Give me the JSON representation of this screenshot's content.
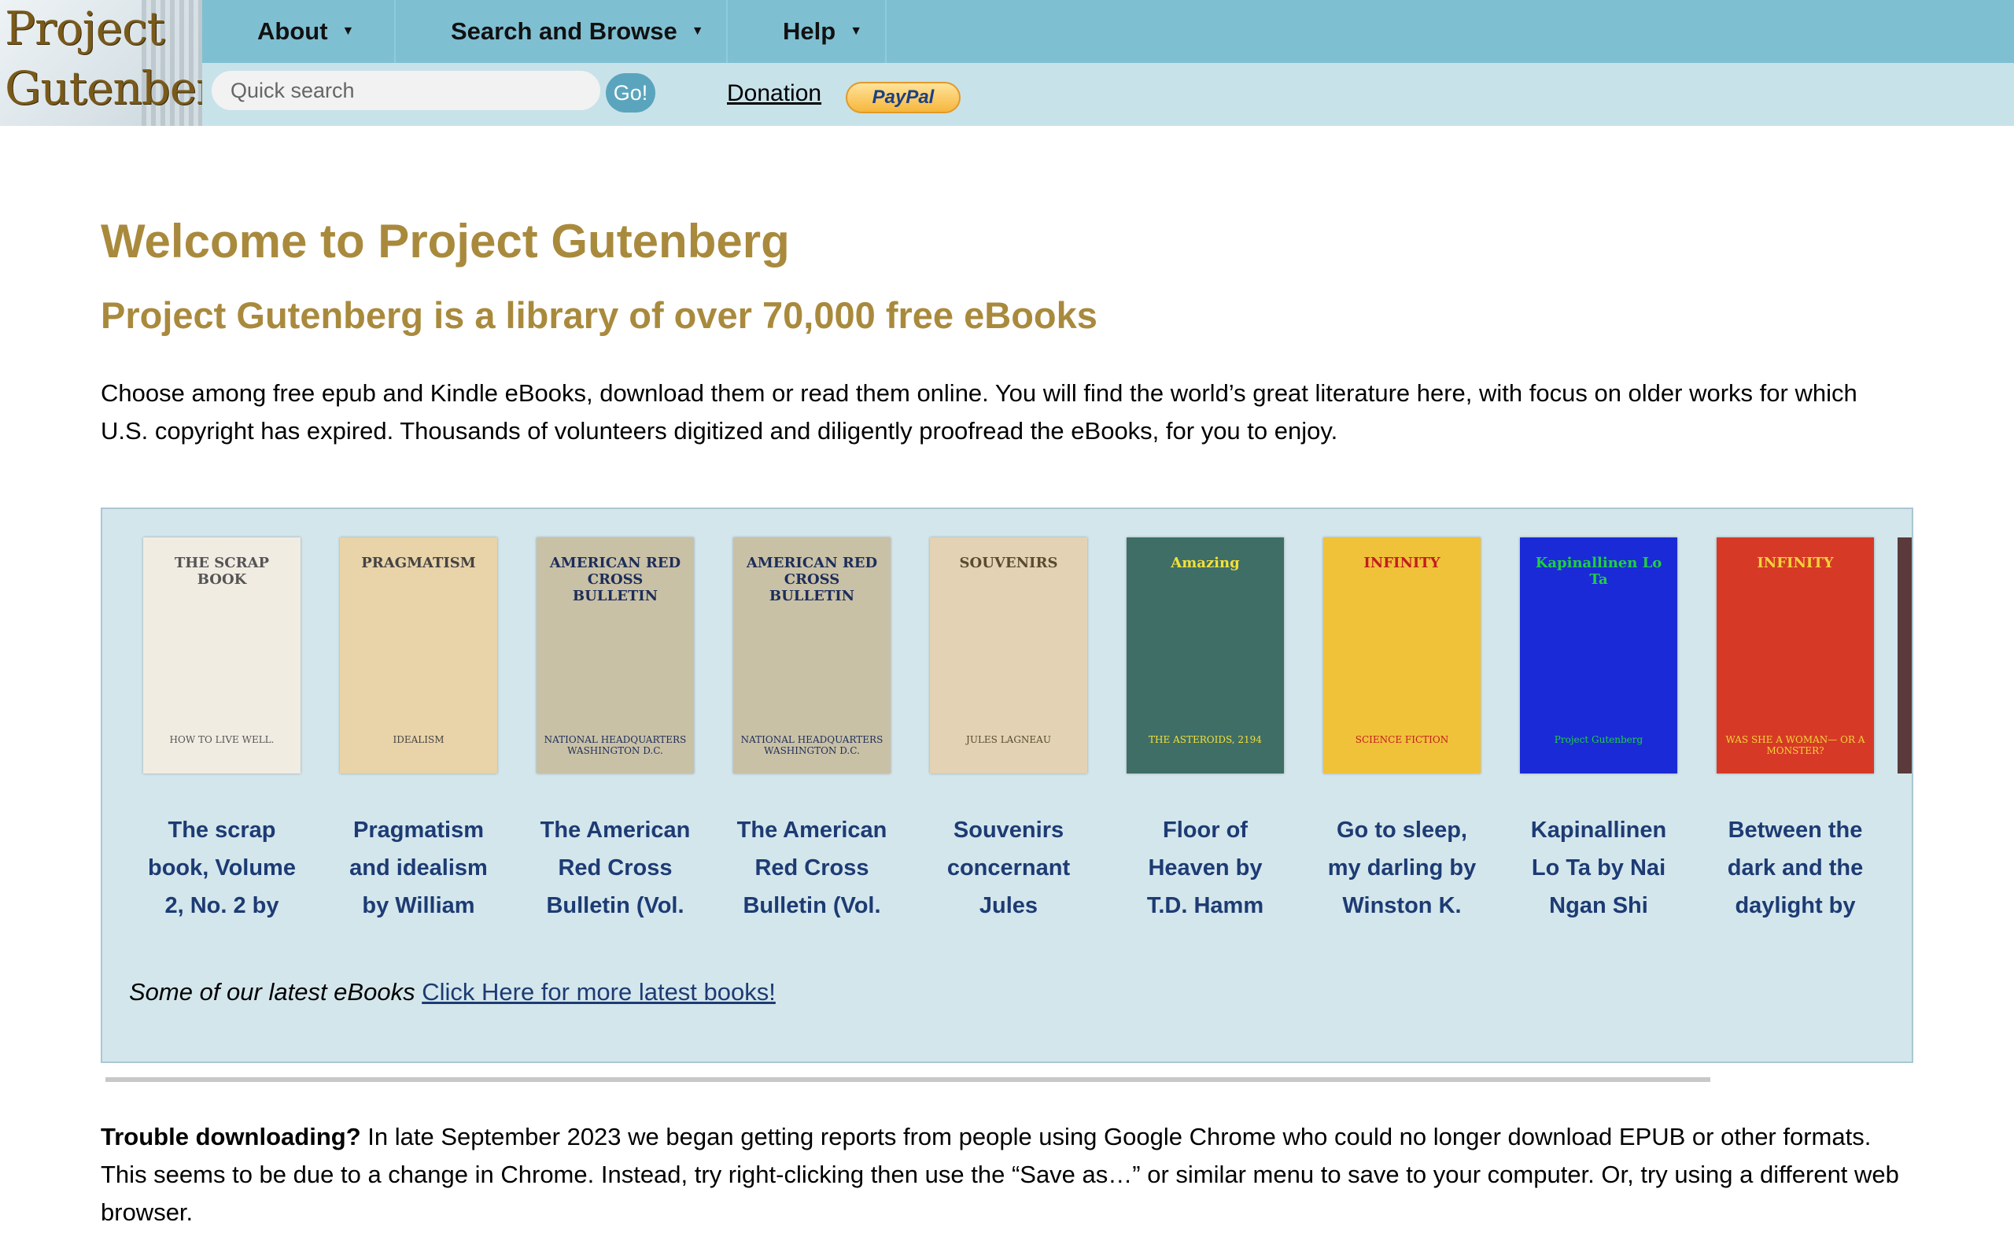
{
  "header": {
    "logo_line1": "Project",
    "logo_line2": "Gutenberg",
    "menu": [
      {
        "label": "About"
      },
      {
        "label": "Search and Browse"
      },
      {
        "label": "Help"
      }
    ],
    "search_placeholder": "Quick search",
    "go_label": "Go!",
    "donation_label": "Donation",
    "paypal_label": "PayPal"
  },
  "main": {
    "title": "Welcome to Project Gutenberg",
    "subtitle": "Project Gutenberg is a library of over 70,000 free eBooks",
    "intro": "Choose among free epub and Kindle eBooks, download them or read them online. You will find the world’s great literature here, with focus on older works for which U.S. copyright has expired. Thousands of volunteers digitized and diligently proofread the eBooks, for you to enjoy."
  },
  "latest_books": [
    {
      "title": "The scrap book, Volume 2, No. 2 by",
      "cover_text": "THE SCRAP BOOK",
      "cover_sub": "HOW TO LIVE WELL.",
      "cover_bg": "#f1ece2",
      "cover_fg": "#555"
    },
    {
      "title": "Pragmatism and idealism by William",
      "cover_text": "PRAGMATISM",
      "cover_sub": "IDEALISM",
      "cover_bg": "#e9d3a8",
      "cover_fg": "#444"
    },
    {
      "title": "The American Red Cross Bulletin (Vol.",
      "cover_text": "AMERICAN RED CROSS BULLETIN",
      "cover_sub": "NATIONAL HEADQUARTERS WASHINGTON D.C.",
      "cover_bg": "#c9c1a6",
      "cover_fg": "#1d2d5a"
    },
    {
      "title": "The American Red Cross Bulletin (Vol.",
      "cover_text": "AMERICAN RED CROSS BULLETIN",
      "cover_sub": "NATIONAL HEADQUARTERS WASHINGTON D.C.",
      "cover_bg": "#c9c1a6",
      "cover_fg": "#1d2d5a"
    },
    {
      "title": "Souvenirs concernant Jules Lagneau",
      "cover_text": "SOUVENIRS",
      "cover_sub": "JULES LAGNEAU",
      "cover_bg": "#e3d3b4",
      "cover_fg": "#5a4a30"
    },
    {
      "title": "Floor of Heaven by T.D. Hamm",
      "cover_text": "Amazing",
      "cover_sub": "THE ASTEROIDS, 2194",
      "cover_bg": "#3e6e66",
      "cover_fg": "#f3e03a"
    },
    {
      "title": "Go to sleep, my darling by Winston K.",
      "cover_text": "INFINITY",
      "cover_sub": "SCIENCE FICTION",
      "cover_bg": "#f0c23a",
      "cover_fg": "#c21d1d"
    },
    {
      "title": "Kapinallinen Lo Ta by Nai Ngan Shi",
      "cover_text": "Kapinallinen Lo Ta",
      "cover_sub": "Project Gutenberg",
      "cover_bg": "#1a2ad6",
      "cover_fg": "#20d040"
    },
    {
      "title": "Between the dark and the daylight by",
      "cover_text": "INFINITY",
      "cover_sub": "WAS SHE A WOMAN— OR A MONSTER?",
      "cover_bg": "#d63a26",
      "cover_fg": "#f5d23a"
    }
  ],
  "latest_caption": "Some of our latest eBooks",
  "latest_link": "Click Here for more latest books!",
  "trouble": {
    "label": "Trouble downloading?",
    "text": "In late September 2023 we began getting reports from people using Google Chrome who could no longer download EPUB or other formats. This seems to be due to a change in Chrome. Instead, try right-clicking then use the “Save as…” or similar menu to save to your computer. Or, try using a different web browser."
  },
  "colors": {
    "nav_top": "#7fbfd2",
    "nav_bottom": "#c8e2ea",
    "heading": "#a98a3d",
    "book_title": "#1d3b73",
    "panel": "#d3e6ec"
  }
}
